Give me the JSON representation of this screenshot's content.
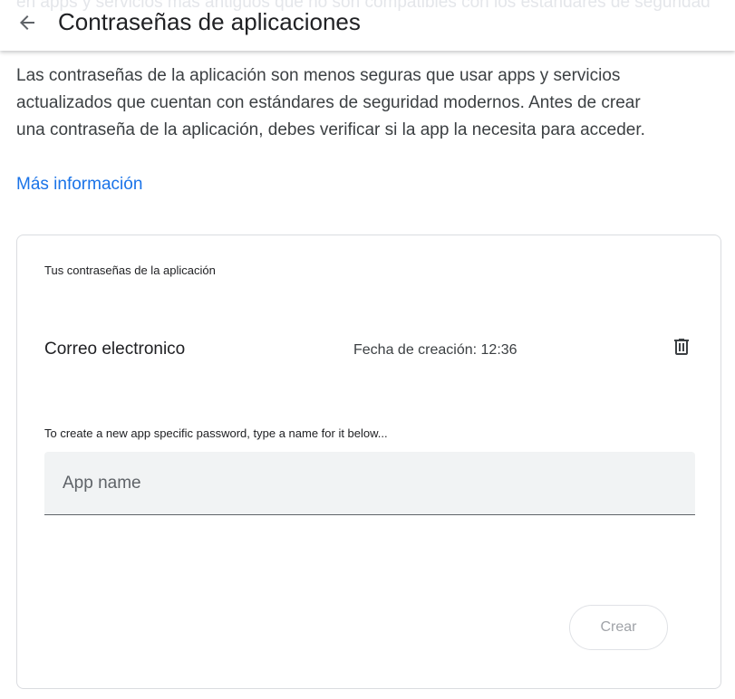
{
  "header": {
    "title": "Contraseñas de aplicaciones",
    "back_icon": "arrow-back-icon",
    "scrolled_text": "en apps y servicios más antiguos que no son compatibles con los estándares de seguridad"
  },
  "intro": {
    "text": "Las contraseñas de la aplicación son menos seguras que usar apps y servicios actualizados que cuentan con estándares de seguridad modernos. Antes de crear una contraseña de la aplicación, debes verificar si la app la necesita para acceder.",
    "link_label": "Más información"
  },
  "card": {
    "heading": "Tus contraseñas de la aplicación",
    "passwords": [
      {
        "name": "Correo electronico",
        "created": "Fecha de creación: 12:36",
        "delete_icon": "trash-icon"
      }
    ],
    "new_label": "To create a new app specific password, type a name for it below...",
    "input_placeholder": "App name",
    "input_value": "",
    "create_button": "Crear"
  },
  "colors": {
    "link": "#1a73e8",
    "text": "#202124",
    "input_bg": "#f1f3f4",
    "disabled_text": "#a0a3a8"
  }
}
